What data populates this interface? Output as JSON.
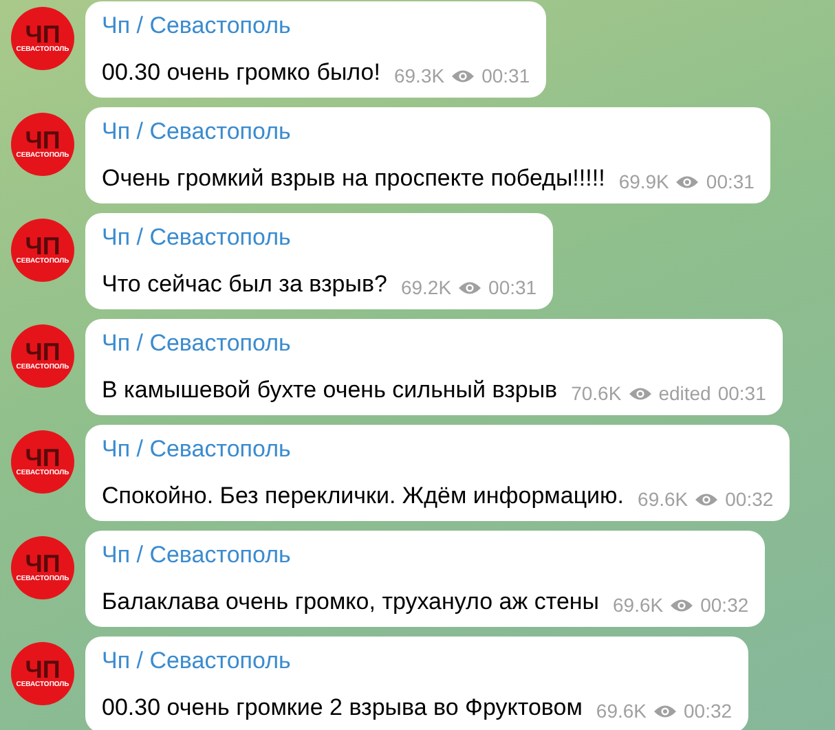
{
  "messages": [
    {
      "avatar": {
        "title": "ЧП",
        "subtitle": "СЕВАСТОПОЛЬ"
      },
      "author": "Чп / Севастополь",
      "text": "00.30 очень громко было!",
      "views": "69.3K",
      "time": "00:31"
    },
    {
      "avatar": {
        "title": "ЧП",
        "subtitle": "СЕВАСТОПОЛЬ"
      },
      "author": "Чп / Севастополь",
      "text": "Очень громкий взрыв на проспекте победы!!!!!",
      "views": "69.9K",
      "time": "00:31"
    },
    {
      "avatar": {
        "title": "ЧП",
        "subtitle": "СЕВАСТОПОЛЬ"
      },
      "author": "Чп / Севастополь",
      "text": "Что сейчас был за взрыв?",
      "views": "69.2K",
      "time": "00:31"
    },
    {
      "avatar": {
        "title": "ЧП",
        "subtitle": "СЕВАСТОПОЛЬ"
      },
      "author": "Чп / Севастополь",
      "text": "В камышевой бухте очень сильный взрыв",
      "views": "70.6K",
      "edited_label": "edited",
      "time": "00:31"
    },
    {
      "avatar": {
        "title": "ЧП",
        "subtitle": "СЕВАСТОПОЛЬ"
      },
      "author": "Чп / Севастополь",
      "text": "Спокойно. Без переклички. Ждём информацию.",
      "views": "69.6K",
      "time": "00:32"
    },
    {
      "avatar": {
        "title": "ЧП",
        "subtitle": "СЕВАСТОПОЛЬ"
      },
      "author": "Чп / Севастополь",
      "text": "Балаклава очень громко, трухануло аж стены",
      "views": "69.6K",
      "time": "00:32"
    },
    {
      "avatar": {
        "title": "ЧП",
        "subtitle": "СЕВАСТОПОЛЬ"
      },
      "author": "Чп / Севастополь",
      "text": "00.30 очень громкие 2 взрыва во Фруктовом",
      "views": "69.6K",
      "time": "00:32"
    }
  ]
}
